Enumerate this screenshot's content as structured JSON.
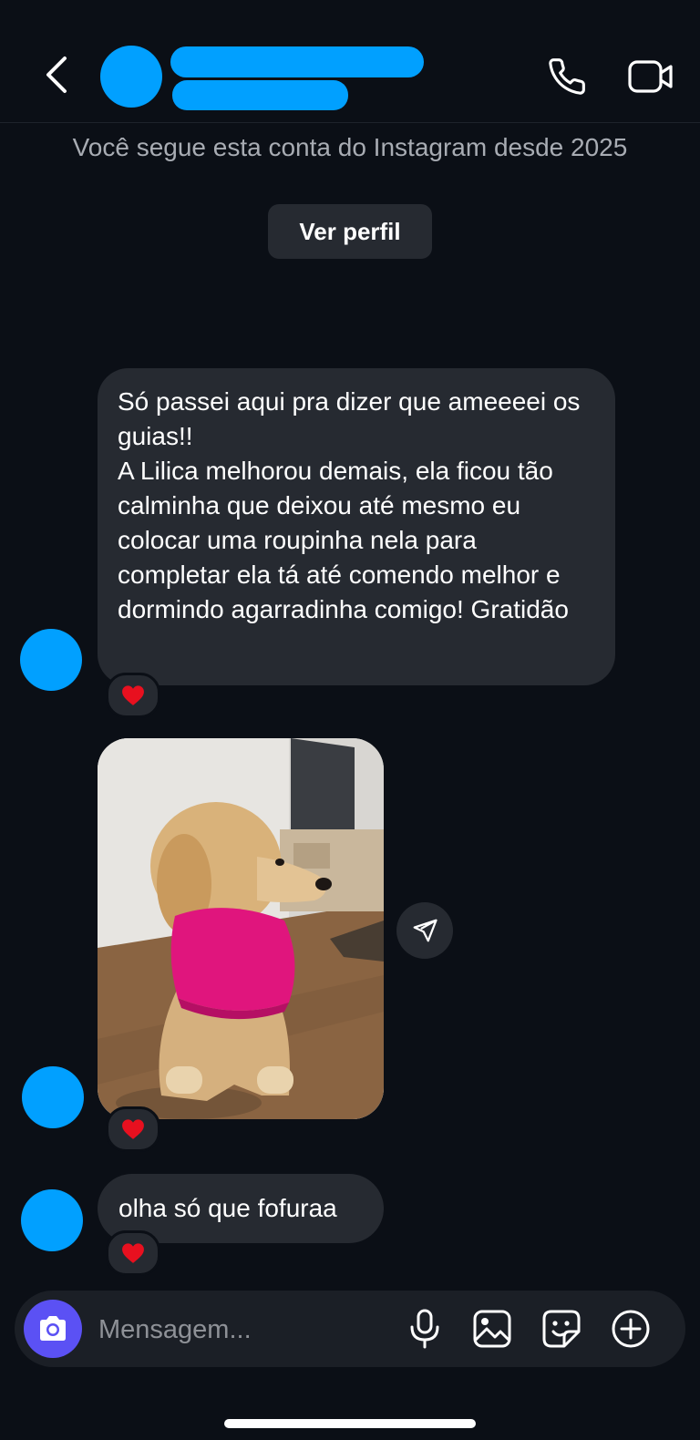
{
  "profile": {
    "follow_info": "Você segue esta conta do Instagram desde 2025",
    "view_profile_label": "Ver perfil"
  },
  "messages": [
    {
      "type": "text",
      "lines": [
        "Só passei aqui pra dizer que ameeeei os guias!!",
        "A Lilica melhorou demais, ela ficou tão calminha que deixou até mesmo eu colocar uma roupinha nela para completar ela tá até comendo melhor e dormindo agarradinha comigo! Gratidão"
      ],
      "reaction": "❤️"
    },
    {
      "type": "photo",
      "reaction": "❤️"
    },
    {
      "type": "text",
      "lines": [
        "olha só que fofuraa"
      ],
      "reaction": "❤️"
    }
  ],
  "composer": {
    "placeholder": "Mensagem..."
  },
  "colors": {
    "background": "#0b0f16",
    "bubble": "#262a31",
    "redaction": "#01a0ff",
    "camera_button": "#5b51f4"
  },
  "icons": [
    "back-icon",
    "phone-icon",
    "video-call-icon",
    "send-icon",
    "camera-icon",
    "microphone-icon",
    "gallery-icon",
    "sticker-icon",
    "add-icon"
  ]
}
